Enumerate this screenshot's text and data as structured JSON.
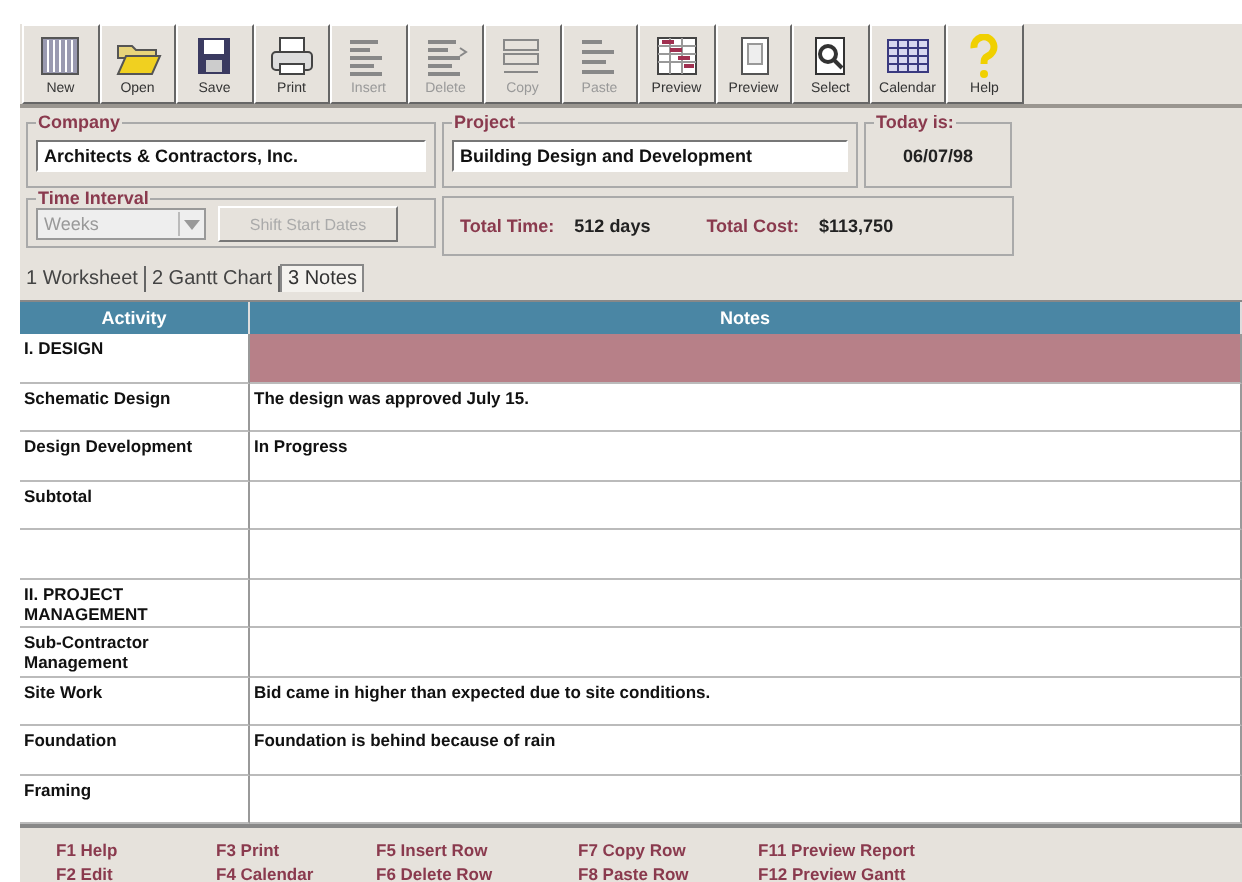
{
  "toolbar": [
    {
      "label": "New",
      "kind": "new",
      "disabled": false
    },
    {
      "label": "Open",
      "kind": "open",
      "disabled": false
    },
    {
      "label": "Save",
      "kind": "save",
      "disabled": false
    },
    {
      "label": "Print",
      "kind": "print",
      "disabled": false
    },
    {
      "label": "Insert",
      "kind": "insert",
      "disabled": true
    },
    {
      "label": "Delete",
      "kind": "delete",
      "disabled": true
    },
    {
      "label": "Copy",
      "kind": "copy",
      "disabled": true
    },
    {
      "label": "Paste",
      "kind": "paste",
      "disabled": true
    },
    {
      "label": "Preview",
      "kind": "gantt",
      "disabled": false
    },
    {
      "label": "Preview",
      "kind": "page",
      "disabled": false
    },
    {
      "label": "Select",
      "kind": "select",
      "disabled": false
    },
    {
      "label": "Calendar",
      "kind": "calendar",
      "disabled": false
    },
    {
      "label": "Help",
      "kind": "help",
      "disabled": false
    }
  ],
  "company": {
    "title": "Company",
    "value": "Architects & Contractors, Inc."
  },
  "project": {
    "title": "Project",
    "value": "Building Design and Development"
  },
  "today": {
    "title": "Today is:",
    "value": "06/07/98"
  },
  "time_interval": {
    "title": "Time Interval",
    "value": "Weeks",
    "disabled": true,
    "button": "Shift Start Dates"
  },
  "totals": [
    {
      "label": "Total Time:",
      "value": "512 days"
    },
    {
      "label": "Total Cost:",
      "value": "$113,750"
    }
  ],
  "tabs": [
    {
      "label": "1 Worksheet",
      "selected": false
    },
    {
      "label": "2 Gantt Chart",
      "selected": false
    },
    {
      "label": "3 Notes",
      "selected": true
    }
  ],
  "table": {
    "columns": [
      "Activity",
      "Notes"
    ],
    "rows": [
      {
        "activity": "I. DESIGN",
        "notes": "",
        "selected": true
      },
      {
        "activity": "Schematic Design",
        "notes": "The design was approved July 15.",
        "selected": false
      },
      {
        "activity": "Design Development",
        "notes": "In Progress",
        "selected": false
      },
      {
        "activity": "Subtotal",
        "notes": "",
        "selected": false
      },
      {
        "activity": "",
        "notes": "",
        "selected": false
      },
      {
        "activity": "II. PROJECT MANAGEMENT",
        "notes": "",
        "selected": false
      },
      {
        "activity": "Sub-Contractor Management",
        "notes": "",
        "selected": false
      },
      {
        "activity": "Site Work",
        "notes": "Bid came in higher than expected due to site conditions.",
        "selected": false
      },
      {
        "activity": "Foundation",
        "notes": "Foundation is behind because of rain",
        "selected": false
      },
      {
        "activity": "Framing",
        "notes": "",
        "selected": false
      }
    ]
  },
  "status_bar": [
    [
      "F1 Help",
      "F2 Edit"
    ],
    [
      "F3 Print",
      "F4 Calendar"
    ],
    [
      "F5 Insert Row",
      "F6 Delete Row"
    ],
    [
      "F7 Copy Row",
      "F8 Paste Row"
    ],
    [
      "F11 Preview Report",
      "F12 Preview Gantt"
    ]
  ]
}
